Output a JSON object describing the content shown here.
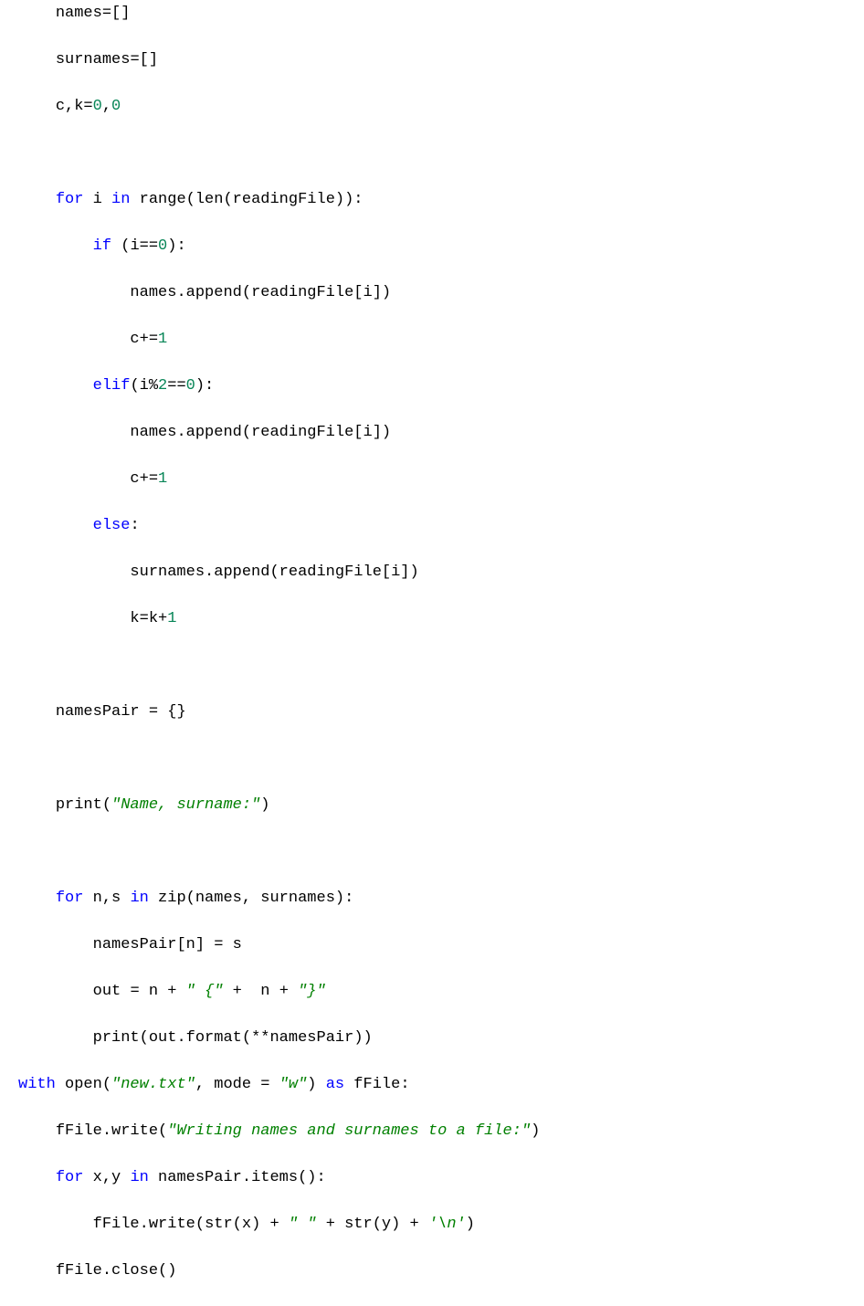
{
  "lines": [
    {
      "indent": 1,
      "tokens": [
        {
          "t": "id",
          "v": "names"
        },
        {
          "t": "op",
          "v": "=[]"
        }
      ]
    },
    {
      "indent": 1,
      "tokens": [
        {
          "t": "id",
          "v": "surnames"
        },
        {
          "t": "op",
          "v": "=[]"
        }
      ]
    },
    {
      "indent": 1,
      "tokens": [
        {
          "t": "id",
          "v": "c"
        },
        {
          "t": "op",
          "v": ","
        },
        {
          "t": "id",
          "v": "k"
        },
        {
          "t": "op",
          "v": "="
        },
        {
          "t": "num",
          "v": "0"
        },
        {
          "t": "op",
          "v": ","
        },
        {
          "t": "num",
          "v": "0"
        }
      ]
    },
    {
      "indent": 1,
      "tokens": []
    },
    {
      "indent": 1,
      "tokens": [
        {
          "t": "kw",
          "v": "for"
        },
        {
          "t": "id",
          "v": " i "
        },
        {
          "t": "kw",
          "v": "in"
        },
        {
          "t": "id",
          "v": " range"
        },
        {
          "t": "op",
          "v": "("
        },
        {
          "t": "id",
          "v": "len"
        },
        {
          "t": "op",
          "v": "("
        },
        {
          "t": "id",
          "v": "readingFile"
        },
        {
          "t": "op",
          "v": ")):"
        }
      ]
    },
    {
      "indent": 2,
      "tokens": [
        {
          "t": "kw",
          "v": "if"
        },
        {
          "t": "op",
          "v": " ("
        },
        {
          "t": "id",
          "v": "i"
        },
        {
          "t": "op",
          "v": "=="
        },
        {
          "t": "num",
          "v": "0"
        },
        {
          "t": "op",
          "v": "):"
        }
      ]
    },
    {
      "indent": 3,
      "tokens": [
        {
          "t": "id",
          "v": "names"
        },
        {
          "t": "op",
          "v": "."
        },
        {
          "t": "id",
          "v": "append"
        },
        {
          "t": "op",
          "v": "("
        },
        {
          "t": "id",
          "v": "readingFile"
        },
        {
          "t": "op",
          "v": "["
        },
        {
          "t": "id",
          "v": "i"
        },
        {
          "t": "op",
          "v": "])"
        }
      ]
    },
    {
      "indent": 3,
      "tokens": [
        {
          "t": "id",
          "v": "c"
        },
        {
          "t": "op",
          "v": "+="
        },
        {
          "t": "num",
          "v": "1"
        }
      ]
    },
    {
      "indent": 2,
      "tokens": [
        {
          "t": "kw",
          "v": "elif"
        },
        {
          "t": "op",
          "v": "("
        },
        {
          "t": "id",
          "v": "i"
        },
        {
          "t": "op",
          "v": "%"
        },
        {
          "t": "num",
          "v": "2"
        },
        {
          "t": "op",
          "v": "=="
        },
        {
          "t": "num",
          "v": "0"
        },
        {
          "t": "op",
          "v": "):"
        }
      ]
    },
    {
      "indent": 3,
      "tokens": [
        {
          "t": "id",
          "v": "names"
        },
        {
          "t": "op",
          "v": "."
        },
        {
          "t": "id",
          "v": "append"
        },
        {
          "t": "op",
          "v": "("
        },
        {
          "t": "id",
          "v": "readingFile"
        },
        {
          "t": "op",
          "v": "["
        },
        {
          "t": "id",
          "v": "i"
        },
        {
          "t": "op",
          "v": "])"
        }
      ]
    },
    {
      "indent": 3,
      "tokens": [
        {
          "t": "id",
          "v": "c"
        },
        {
          "t": "op",
          "v": "+="
        },
        {
          "t": "num",
          "v": "1"
        }
      ]
    },
    {
      "indent": 2,
      "tokens": [
        {
          "t": "kw",
          "v": "else"
        },
        {
          "t": "op",
          "v": ":"
        }
      ]
    },
    {
      "indent": 3,
      "tokens": [
        {
          "t": "id",
          "v": "surnames"
        },
        {
          "t": "op",
          "v": "."
        },
        {
          "t": "id",
          "v": "append"
        },
        {
          "t": "op",
          "v": "("
        },
        {
          "t": "id",
          "v": "readingFile"
        },
        {
          "t": "op",
          "v": "["
        },
        {
          "t": "id",
          "v": "i"
        },
        {
          "t": "op",
          "v": "])"
        }
      ]
    },
    {
      "indent": 3,
      "tokens": [
        {
          "t": "id",
          "v": "k"
        },
        {
          "t": "op",
          "v": "="
        },
        {
          "t": "id",
          "v": "k"
        },
        {
          "t": "op",
          "v": "+"
        },
        {
          "t": "num",
          "v": "1"
        }
      ]
    },
    {
      "indent": 1,
      "tokens": []
    },
    {
      "indent": 1,
      "tokens": [
        {
          "t": "id",
          "v": "namesPair "
        },
        {
          "t": "op",
          "v": "= {}"
        }
      ]
    },
    {
      "indent": 1,
      "tokens": []
    },
    {
      "indent": 1,
      "tokens": [
        {
          "t": "id",
          "v": "print"
        },
        {
          "t": "op",
          "v": "("
        },
        {
          "t": "str",
          "v": "\"Name, surname:\""
        },
        {
          "t": "op",
          "v": ")"
        }
      ]
    },
    {
      "indent": 1,
      "tokens": []
    },
    {
      "indent": 1,
      "tokens": [
        {
          "t": "kw",
          "v": "for"
        },
        {
          "t": "id",
          "v": " n"
        },
        {
          "t": "op",
          "v": ","
        },
        {
          "t": "id",
          "v": "s "
        },
        {
          "t": "kw",
          "v": "in"
        },
        {
          "t": "id",
          "v": " zip"
        },
        {
          "t": "op",
          "v": "("
        },
        {
          "t": "id",
          "v": "names"
        },
        {
          "t": "op",
          "v": ", "
        },
        {
          "t": "id",
          "v": "surnames"
        },
        {
          "t": "op",
          "v": "):"
        }
      ]
    },
    {
      "indent": 2,
      "tokens": [
        {
          "t": "id",
          "v": "namesPair"
        },
        {
          "t": "op",
          "v": "["
        },
        {
          "t": "id",
          "v": "n"
        },
        {
          "t": "op",
          "v": "] = "
        },
        {
          "t": "id",
          "v": "s"
        }
      ]
    },
    {
      "indent": 2,
      "tokens": [
        {
          "t": "id",
          "v": "out "
        },
        {
          "t": "op",
          "v": "= "
        },
        {
          "t": "id",
          "v": "n "
        },
        {
          "t": "op",
          "v": "+ "
        },
        {
          "t": "str",
          "v": "\" {\""
        },
        {
          "t": "op",
          "v": " +  "
        },
        {
          "t": "id",
          "v": "n "
        },
        {
          "t": "op",
          "v": "+ "
        },
        {
          "t": "str",
          "v": "\"}\""
        }
      ]
    },
    {
      "indent": 2,
      "tokens": [
        {
          "t": "id",
          "v": "print"
        },
        {
          "t": "op",
          "v": "("
        },
        {
          "t": "id",
          "v": "out"
        },
        {
          "t": "op",
          "v": "."
        },
        {
          "t": "id",
          "v": "format"
        },
        {
          "t": "op",
          "v": "(**"
        },
        {
          "t": "id",
          "v": "namesPair"
        },
        {
          "t": "op",
          "v": "))"
        }
      ]
    },
    {
      "indent": 0,
      "tokens": [
        {
          "t": "kw",
          "v": "with"
        },
        {
          "t": "id",
          "v": " open"
        },
        {
          "t": "op",
          "v": "("
        },
        {
          "t": "str",
          "v": "\"new.txt\""
        },
        {
          "t": "op",
          "v": ", "
        },
        {
          "t": "id",
          "v": "mode "
        },
        {
          "t": "op",
          "v": "= "
        },
        {
          "t": "str",
          "v": "\"w\""
        },
        {
          "t": "op",
          "v": ") "
        },
        {
          "t": "kw",
          "v": "as"
        },
        {
          "t": "id",
          "v": " fFile"
        },
        {
          "t": "op",
          "v": ":"
        }
      ]
    },
    {
      "indent": 1,
      "tokens": [
        {
          "t": "id",
          "v": "fFile"
        },
        {
          "t": "op",
          "v": "."
        },
        {
          "t": "id",
          "v": "write"
        },
        {
          "t": "op",
          "v": "("
        },
        {
          "t": "str",
          "v": "\"Writing names and surnames to a file:\""
        },
        {
          "t": "op",
          "v": ")"
        }
      ]
    },
    {
      "indent": 1,
      "tokens": [
        {
          "t": "kw",
          "v": "for"
        },
        {
          "t": "id",
          "v": " x"
        },
        {
          "t": "op",
          "v": ","
        },
        {
          "t": "id",
          "v": "y "
        },
        {
          "t": "kw",
          "v": "in"
        },
        {
          "t": "id",
          "v": " namesPair"
        },
        {
          "t": "op",
          "v": "."
        },
        {
          "t": "id",
          "v": "items"
        },
        {
          "t": "op",
          "v": "():"
        }
      ]
    },
    {
      "indent": 2,
      "tokens": [
        {
          "t": "id",
          "v": "fFile"
        },
        {
          "t": "op",
          "v": "."
        },
        {
          "t": "id",
          "v": "write"
        },
        {
          "t": "op",
          "v": "("
        },
        {
          "t": "id",
          "v": "str"
        },
        {
          "t": "op",
          "v": "("
        },
        {
          "t": "id",
          "v": "x"
        },
        {
          "t": "op",
          "v": ") + "
        },
        {
          "t": "str",
          "v": "\" \""
        },
        {
          "t": "op",
          "v": " + "
        },
        {
          "t": "id",
          "v": "str"
        },
        {
          "t": "op",
          "v": "("
        },
        {
          "t": "id",
          "v": "y"
        },
        {
          "t": "op",
          "v": ") + "
        },
        {
          "t": "str",
          "v": "'\\n'"
        },
        {
          "t": "op",
          "v": ")"
        }
      ]
    },
    {
      "indent": 1,
      "tokens": [
        {
          "t": "id",
          "v": "fFile"
        },
        {
          "t": "op",
          "v": "."
        },
        {
          "t": "id",
          "v": "close"
        },
        {
          "t": "op",
          "v": "()"
        }
      ]
    }
  ],
  "indent_unit": "    "
}
